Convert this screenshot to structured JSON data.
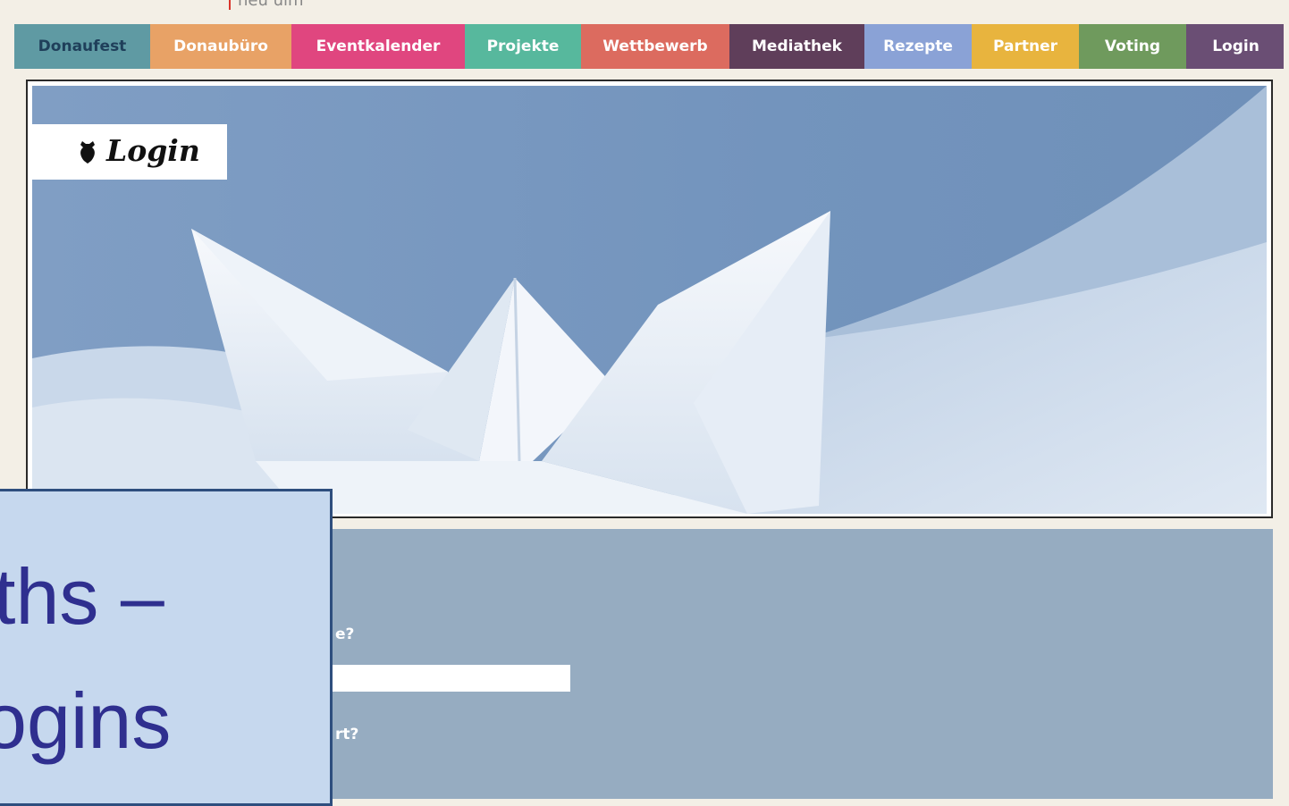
{
  "header": {
    "tagline_partial": "neu ulm"
  },
  "nav": [
    {
      "label": "Donaufest",
      "bg": "#5f9aa3",
      "fg": "#1f3f5a",
      "w": 152
    },
    {
      "label": "Donaubüro",
      "bg": "#e8a266",
      "fg": "#ffffff",
      "w": 158
    },
    {
      "label": "Eventkalender",
      "bg": "#e0467f",
      "fg": "#ffffff",
      "w": 194
    },
    {
      "label": "Projekte",
      "bg": "#57b89d",
      "fg": "#ffffff",
      "w": 130
    },
    {
      "label": "Wettbewerb",
      "bg": "#dc6b5f",
      "fg": "#ffffff",
      "w": 166
    },
    {
      "label": "Mediathek",
      "bg": "#5f3e5a",
      "fg": "#ffffff",
      "w": 151
    },
    {
      "label": "Rezepte",
      "bg": "#8aa2d6",
      "fg": "#ffffff",
      "w": 120
    },
    {
      "label": "Partner",
      "bg": "#e8b43e",
      "fg": "#ffffff",
      "w": 120
    },
    {
      "label": "Voting",
      "bg": "#6f9a5d",
      "fg": "#ffffff",
      "w": 120
    },
    {
      "label": "Login",
      "bg": "#6a4e74",
      "fg": "#ffffff",
      "w": 111
    }
  ],
  "hero": {
    "title": "Login",
    "icon": "bell-pepper-icon"
  },
  "form": {
    "question1_partial": "e?",
    "question2_partial": "rt?",
    "username_value": ""
  },
  "overlay": {
    "line1": "ths –",
    "line2": "ogins"
  },
  "colors": {
    "page_bg": "#f3efe6",
    "hero_sky": "#7d9bc1",
    "form_panel": "#96acc1",
    "overlay_bg": "#c6d8ee",
    "overlay_text": "#2f2f8f"
  }
}
